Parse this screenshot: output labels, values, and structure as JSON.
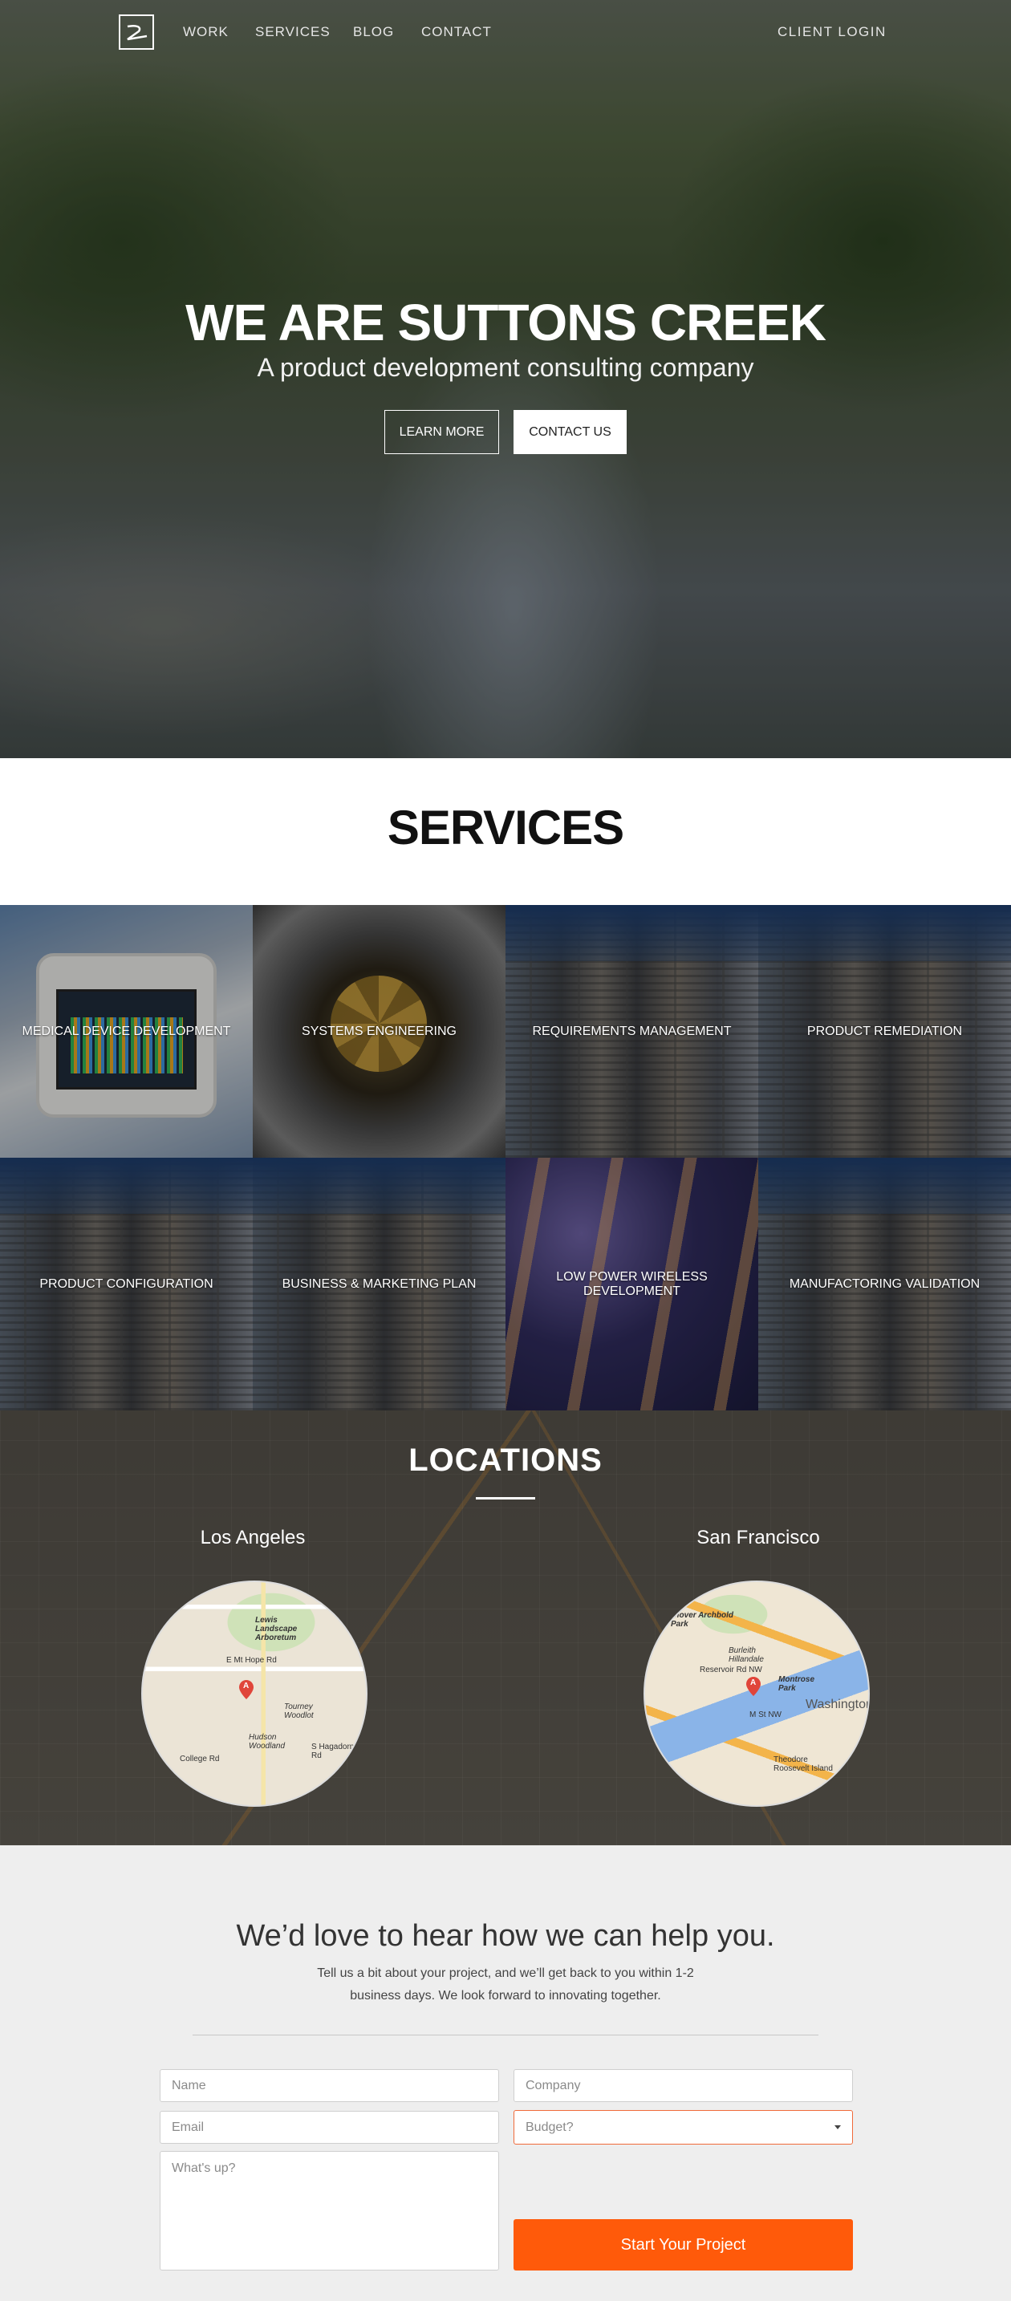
{
  "nav": {
    "links": [
      "WORK",
      "SERVICES",
      "BLOG",
      "CONTACT"
    ],
    "client_login": "CLIENT LOGIN"
  },
  "hero": {
    "title": "WE ARE SUTTONS CREEK",
    "subtitle": "A product development consulting company",
    "learn_more": "LEARN MORE",
    "contact_us": "CONTACT US"
  },
  "services": {
    "title": "SERVICES",
    "tiles": [
      "MEDICAL DEVICE DEVELOPMENT",
      "SYSTEMS ENGINEERING",
      "REQUIREMENTS MANAGEMENT",
      "PRODUCT REMEDIATION",
      "PRODUCT  CONFIGURATION",
      "BUSINESS & MARKETING PLAN",
      "LOW POWER WIRELESS DEVELOPMENT",
      "MANUFACTORING VALIDATION"
    ]
  },
  "locations": {
    "title": "LOCATIONS",
    "cities": [
      "Los Angeles",
      "San Francisco"
    ],
    "la_map_labels": [
      "Lewis Landscape Arboretum",
      "E Mt Hope Rd",
      "Tourney Woodlot",
      "Hudson Woodland",
      "College Rd",
      "S Hagadorn Rd"
    ],
    "sf_map_labels": [
      "Glover Archbold Park",
      "Burleith Hillandale",
      "Reservoir Rd NW",
      "Montrose Park",
      "M St NW",
      "Washington",
      "Theodore Roosevelt Island"
    ],
    "pin_letter": "A"
  },
  "contact": {
    "title": "We’d love to hear how we can help you.",
    "text": "Tell us a bit about your project, and we’ll get back to you within 1-2 business days. We look forward to innovating together.",
    "name_placeholder": "Name",
    "company_placeholder": "Company",
    "email_placeholder": "Email",
    "budget_placeholder": "Budget?",
    "message_placeholder": "What's up?",
    "submit": "Start Your Project"
  },
  "colors": {
    "accent": "#ff5a0a",
    "select_border": "#f06a3a"
  }
}
